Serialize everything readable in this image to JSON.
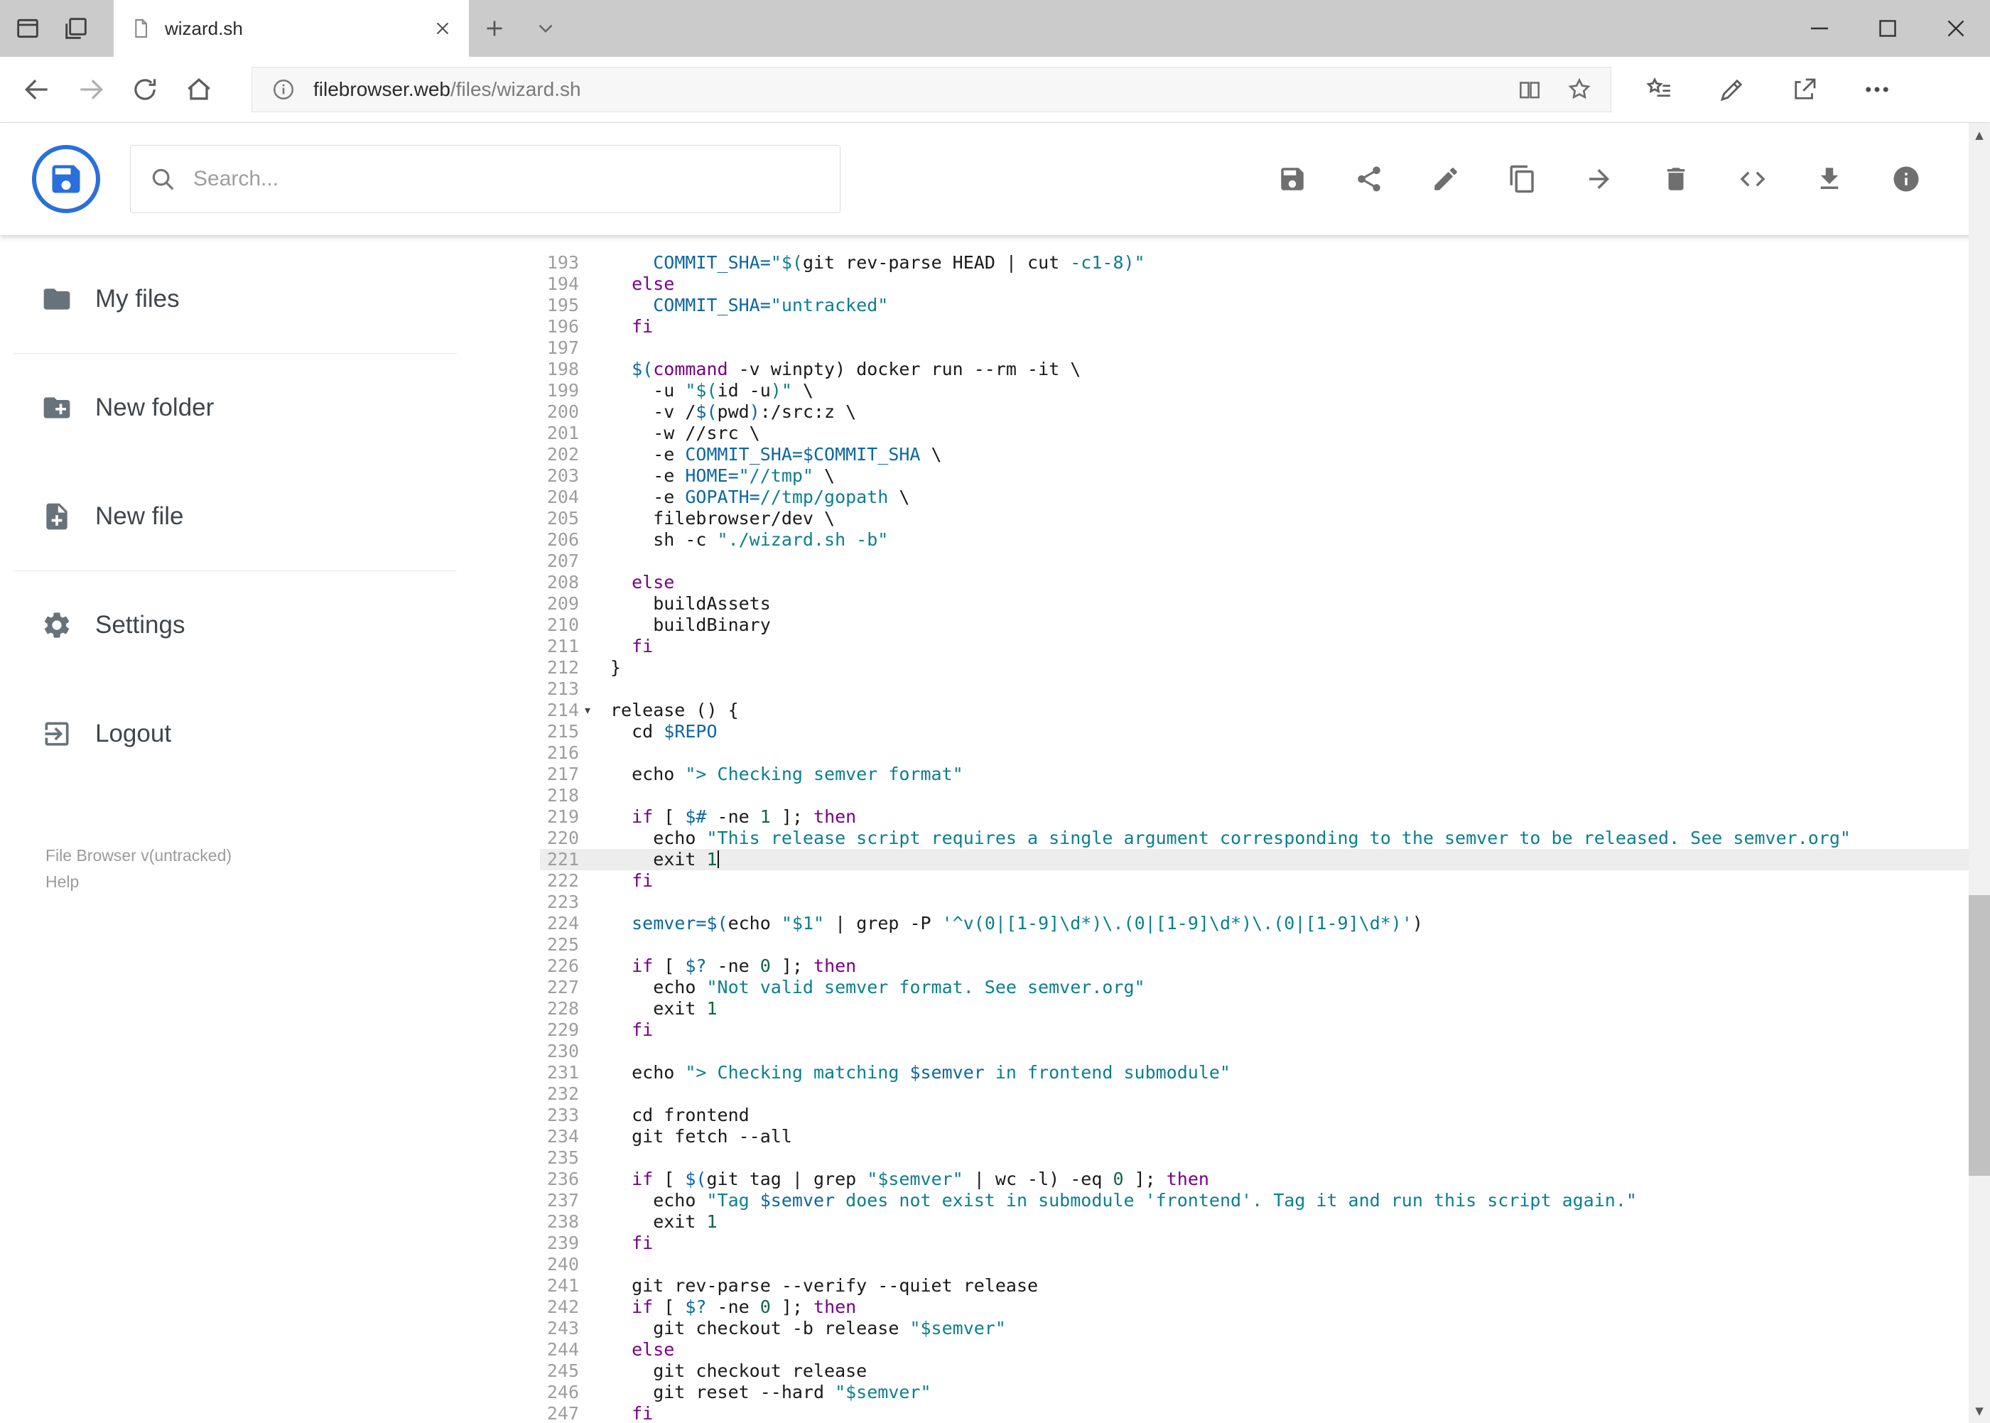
{
  "browser": {
    "tab_title": "wizard.sh",
    "url_domain": "filebrowser.web",
    "url_path": "/files/wizard.sh",
    "nav_icons": [
      "back",
      "forward",
      "refresh",
      "home"
    ],
    "url_icons": [
      "info",
      "reading-view",
      "favorite-star"
    ],
    "action_icons": [
      "hub",
      "web-note",
      "share",
      "more"
    ],
    "window_controls": [
      "minimize",
      "maximize",
      "close"
    ]
  },
  "app": {
    "search_placeholder": "Search...",
    "toolbar_icons": [
      "save",
      "share",
      "edit",
      "copy",
      "move",
      "delete",
      "code",
      "download",
      "info"
    ],
    "sidebar": {
      "items": [
        {
          "label": "My files",
          "icon": "folder"
        },
        {
          "label": "New folder",
          "icon": "create-new-folder"
        },
        {
          "label": "New file",
          "icon": "note-add"
        },
        {
          "label": "Settings",
          "icon": "settings"
        },
        {
          "label": "Logout",
          "icon": "logout"
        }
      ],
      "version": "File Browser v(untracked)",
      "help": "Help"
    }
  },
  "colors": {
    "keyword": "#770088",
    "string": "#0b7f8e",
    "variable": "#0d67a0",
    "number": "#116644",
    "logo_blue": "#2a6fdb"
  },
  "editor": {
    "language": "shell",
    "active_line": 221,
    "fold_line": 214,
    "lines": [
      [
        193,
        [
          [
            "p",
            "    "
          ],
          [
            "v",
            "COMMIT_SHA="
          ],
          [
            "s",
            "\"$("
          ],
          [
            "p",
            "git rev-parse HEAD | cut "
          ],
          [
            "s",
            "-c1-8)\""
          ]
        ]
      ],
      [
        194,
        [
          [
            "p",
            "  "
          ],
          [
            "k",
            "else"
          ]
        ]
      ],
      [
        195,
        [
          [
            "p",
            "    "
          ],
          [
            "v",
            "COMMIT_SHA="
          ],
          [
            "s",
            "\"untracked\""
          ]
        ]
      ],
      [
        196,
        [
          [
            "p",
            "  "
          ],
          [
            "k",
            "fi"
          ]
        ]
      ],
      [
        197,
        []
      ],
      [
        198,
        [
          [
            "p",
            "  "
          ],
          [
            "v",
            "$("
          ],
          [
            "k",
            "command"
          ],
          [
            "p",
            " -v winpty) docker run --rm -it \\"
          ]
        ]
      ],
      [
        199,
        [
          [
            "p",
            "    -u "
          ],
          [
            "s",
            "\"$("
          ],
          [
            "p",
            "id -u"
          ],
          [
            "s",
            ")\""
          ],
          [
            "p",
            " \\"
          ]
        ]
      ],
      [
        200,
        [
          [
            "p",
            "    -v /"
          ],
          [
            "v",
            "$("
          ],
          [
            "p",
            "pwd"
          ],
          [
            "v",
            ")"
          ],
          [
            "p",
            ":/src:z \\"
          ]
        ]
      ],
      [
        201,
        [
          [
            "p",
            "    -w //src \\"
          ]
        ]
      ],
      [
        202,
        [
          [
            "p",
            "    -e "
          ],
          [
            "v",
            "COMMIT_SHA=$COMMIT_SHA"
          ],
          [
            "p",
            " \\"
          ]
        ]
      ],
      [
        203,
        [
          [
            "p",
            "    -e "
          ],
          [
            "v",
            "HOME="
          ],
          [
            "s",
            "\"//tmp\""
          ],
          [
            "p",
            " \\"
          ]
        ]
      ],
      [
        204,
        [
          [
            "p",
            "    -e "
          ],
          [
            "v",
            "GOPATH="
          ],
          [
            "s",
            "//tmp/gopath"
          ],
          [
            "p",
            " \\"
          ]
        ]
      ],
      [
        205,
        [
          [
            "p",
            "    filebrowser/dev \\"
          ]
        ]
      ],
      [
        206,
        [
          [
            "p",
            "    sh -c "
          ],
          [
            "s",
            "\"./wizard.sh -b\""
          ]
        ]
      ],
      [
        207,
        []
      ],
      [
        208,
        [
          [
            "p",
            "  "
          ],
          [
            "k",
            "else"
          ]
        ]
      ],
      [
        209,
        [
          [
            "p",
            "    buildAssets"
          ]
        ]
      ],
      [
        210,
        [
          [
            "p",
            "    buildBinary"
          ]
        ]
      ],
      [
        211,
        [
          [
            "p",
            "  "
          ],
          [
            "k",
            "fi"
          ]
        ]
      ],
      [
        212,
        [
          [
            "p",
            "}"
          ]
        ]
      ],
      [
        213,
        []
      ],
      [
        214,
        [
          [
            "p",
            "release () {"
          ]
        ]
      ],
      [
        215,
        [
          [
            "p",
            "  cd "
          ],
          [
            "v",
            "$REPO"
          ]
        ]
      ],
      [
        216,
        []
      ],
      [
        217,
        [
          [
            "p",
            "  echo "
          ],
          [
            "s",
            "\"> Checking semver format\""
          ]
        ]
      ],
      [
        218,
        []
      ],
      [
        219,
        [
          [
            "p",
            "  "
          ],
          [
            "k",
            "if"
          ],
          [
            "p",
            " [ "
          ],
          [
            "v",
            "$#"
          ],
          [
            "p",
            " -ne "
          ],
          [
            "n",
            "1"
          ],
          [
            "p",
            " ]; "
          ],
          [
            "k",
            "then"
          ]
        ]
      ],
      [
        220,
        [
          [
            "p",
            "    echo "
          ],
          [
            "s",
            "\"This release script requires a single argument corresponding to the semver to be released. See semver.org\""
          ]
        ]
      ],
      [
        221,
        [
          [
            "p",
            "    exit "
          ],
          [
            "n",
            "1"
          ]
        ]
      ],
      [
        222,
        [
          [
            "p",
            "  "
          ],
          [
            "k",
            "fi"
          ]
        ]
      ],
      [
        223,
        []
      ],
      [
        224,
        [
          [
            "p",
            "  "
          ],
          [
            "v",
            "semver=$("
          ],
          [
            "p",
            "echo "
          ],
          [
            "s",
            "\"$1\""
          ],
          [
            "p",
            " | grep -P "
          ],
          [
            "s",
            "'^v(0|[1-9]\\d*)\\.(0|[1-9]\\d*)\\.(0|[1-9]\\d*)'"
          ],
          [
            "p",
            ")"
          ]
        ]
      ],
      [
        225,
        []
      ],
      [
        226,
        [
          [
            "p",
            "  "
          ],
          [
            "k",
            "if"
          ],
          [
            "p",
            " [ "
          ],
          [
            "v",
            "$?"
          ],
          [
            "p",
            " -ne "
          ],
          [
            "n",
            "0"
          ],
          [
            "p",
            " ]; "
          ],
          [
            "k",
            "then"
          ]
        ]
      ],
      [
        227,
        [
          [
            "p",
            "    echo "
          ],
          [
            "s",
            "\"Not valid semver format. See semver.org\""
          ]
        ]
      ],
      [
        228,
        [
          [
            "p",
            "    exit "
          ],
          [
            "n",
            "1"
          ]
        ]
      ],
      [
        229,
        [
          [
            "p",
            "  "
          ],
          [
            "k",
            "fi"
          ]
        ]
      ],
      [
        230,
        []
      ],
      [
        231,
        [
          [
            "p",
            "  echo "
          ],
          [
            "s",
            "\"> Checking matching "
          ],
          [
            "v",
            "$semver"
          ],
          [
            "s",
            " in frontend submodule\""
          ]
        ]
      ],
      [
        232,
        []
      ],
      [
        233,
        [
          [
            "p",
            "  cd frontend"
          ]
        ]
      ],
      [
        234,
        [
          [
            "p",
            "  git fetch --all"
          ]
        ]
      ],
      [
        235,
        []
      ],
      [
        236,
        [
          [
            "p",
            "  "
          ],
          [
            "k",
            "if"
          ],
          [
            "p",
            " [ "
          ],
          [
            "v",
            "$("
          ],
          [
            "p",
            "git tag | grep "
          ],
          [
            "s",
            "\"$semver\""
          ],
          [
            "p",
            " | wc -l) -eq "
          ],
          [
            "n",
            "0"
          ],
          [
            "p",
            " ]; "
          ],
          [
            "k",
            "then"
          ]
        ]
      ],
      [
        237,
        [
          [
            "p",
            "    echo "
          ],
          [
            "s",
            "\"Tag "
          ],
          [
            "v",
            "$semver"
          ],
          [
            "s",
            " does not exist in submodule 'frontend'. Tag it and run this script again.\""
          ]
        ]
      ],
      [
        238,
        [
          [
            "p",
            "    exit "
          ],
          [
            "n",
            "1"
          ]
        ]
      ],
      [
        239,
        [
          [
            "p",
            "  "
          ],
          [
            "k",
            "fi"
          ]
        ]
      ],
      [
        240,
        []
      ],
      [
        241,
        [
          [
            "p",
            "  git rev-parse --verify --quiet release"
          ]
        ]
      ],
      [
        242,
        [
          [
            "p",
            "  "
          ],
          [
            "k",
            "if"
          ],
          [
            "p",
            " [ "
          ],
          [
            "v",
            "$?"
          ],
          [
            "p",
            " -ne "
          ],
          [
            "n",
            "0"
          ],
          [
            "p",
            " ]; "
          ],
          [
            "k",
            "then"
          ]
        ]
      ],
      [
        243,
        [
          [
            "p",
            "    git checkout -b release "
          ],
          [
            "s",
            "\"$semver\""
          ]
        ]
      ],
      [
        244,
        [
          [
            "p",
            "  "
          ],
          [
            "k",
            "else"
          ]
        ]
      ],
      [
        245,
        [
          [
            "p",
            "    git checkout release"
          ]
        ]
      ],
      [
        246,
        [
          [
            "p",
            "    git reset --hard "
          ],
          [
            "s",
            "\"$semver\""
          ]
        ]
      ],
      [
        247,
        [
          [
            "p",
            "  "
          ],
          [
            "k",
            "fi"
          ]
        ]
      ]
    ]
  }
}
